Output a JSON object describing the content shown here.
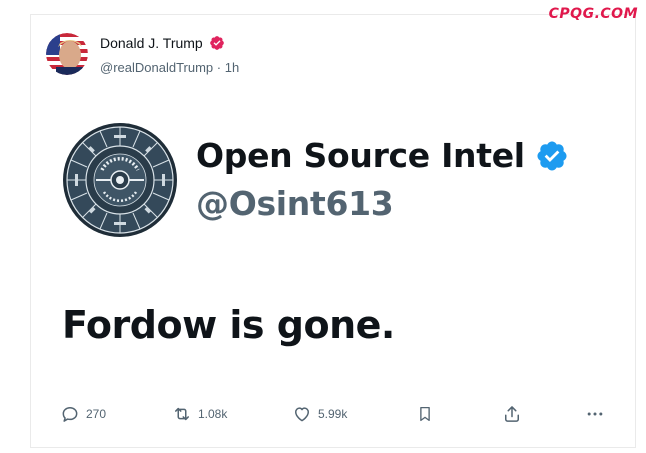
{
  "watermark": "CPQG.COM",
  "author": {
    "name": "Donald J. Trump",
    "handle": "@realDonaldTrump",
    "time_separator": " · ",
    "time": "1h"
  },
  "embedded_image": {
    "account_name": "Open Source Intel",
    "account_handle": "@Osint613",
    "logo_text": "OPEN SOURCE INTEL"
  },
  "post": {
    "text": "Fordow is gone."
  },
  "actions": {
    "replies": "270",
    "reposts": "1.08k",
    "likes": "5.99k"
  },
  "colors": {
    "watermark": "#e0184c",
    "verified_red": "#e0245e",
    "verified_blue": "#1d9bf0",
    "text_primary": "#0f1419",
    "text_secondary": "#536471"
  },
  "icons": {
    "reply": "speech-bubble-icon",
    "repost": "repost-arrows-icon",
    "like": "heart-icon",
    "bookmark": "bookmark-icon",
    "share": "share-upload-icon",
    "more": "more-dots-icon"
  }
}
